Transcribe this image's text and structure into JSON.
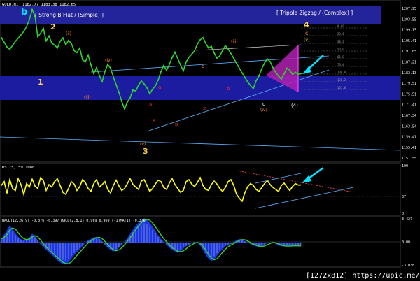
{
  "colors": {
    "bg": "#000000",
    "band": "#1c1ca0",
    "band_top": "#23239a",
    "price": "#2fd32f",
    "rsi": "#ffff00",
    "macd_area": "#1e3cff",
    "macd_line": "#2fd32f",
    "hist": "#c0c0c0",
    "grid": "#404040",
    "cyan": "#00e5ff",
    "magenta": "#b020b0",
    "yellow": "#ffd34a",
    "orange": "#ff8a2a",
    "red": "#ff2a2a",
    "pink": "#ff5fbf",
    "blue_chan": "#5ab0ff",
    "white": "#ffffff"
  },
  "header": {
    "symbol": "GOLD,H1",
    "quote": "1182.77 1183.38 1182.65"
  },
  "main_panel": {
    "label_b": "b",
    "label_2": "2",
    "label_1": "1",
    "label_3": "3",
    "label_4": "4",
    "label_c_orange": "c",
    "label_v_small": "(v)",
    "wave_a": "a",
    "wave_b": "b",
    "wave_c": "c",
    "wave_x": "x",
    "roman_i": "(i)",
    "roman_ii": "(ii)",
    "roman_iii": "(iii)",
    "roman_iv": "(iv)",
    "roman_v": "(v)",
    "paren_4": "(4)",
    "flat_label": "[ Strong B Flat / (Simple) ]",
    "zigzag_label": "[ Tripple Zigzag / (Complex) ]"
  },
  "price_scale": [
    "1207.95",
    "1203.55",
    "1199.15",
    "1195.41",
    "1191.05",
    "1187.21",
    "1183.13",
    "1179.51",
    "1175.51",
    "1171.41",
    "1167.34",
    "1163.54",
    "1159.41",
    "1155.41",
    "1151.55"
  ],
  "rsi_panel": {
    "title": "RSI(5) 59.1088",
    "levels": [
      "100",
      "37",
      "0"
    ]
  },
  "macd_panel": {
    "title": "MACD(12,26,9) -0.376 -0.397  MACD(2,8,1) 0.969 0.969  (-1)MA(1) -0.376",
    "levels": [
      "3.427",
      "0.00",
      "-3.038"
    ]
  },
  "footer": {
    "watermark": "[1272x812] https://upic.me/"
  },
  "fib_levels": [
    "0.00",
    "23.6",
    "38.2",
    "50.0",
    "61.8",
    "76.4",
    "100.0",
    "138.2",
    "161.8"
  ],
  "chart_data": {
    "type": "line",
    "title": "GOLD,H1",
    "series": [
      {
        "name": "GOLD,H1",
        "x": [
          0,
          4,
          8,
          12,
          16,
          20,
          24,
          28,
          32,
          36,
          40,
          44,
          48,
          52,
          56,
          60,
          64,
          68,
          72,
          76,
          80,
          84,
          88,
          92,
          96,
          100,
          104,
          108,
          112,
          116,
          120,
          124,
          128,
          132,
          136,
          140,
          144,
          148,
          152,
          156,
          160,
          164,
          168,
          172,
          176,
          180,
          184,
          188,
          192,
          196,
          200,
          204,
          208,
          212,
          216,
          220,
          224,
          228,
          232,
          236,
          240,
          244,
          248,
          252,
          256,
          260,
          264,
          268,
          272,
          276,
          280,
          284,
          288,
          292,
          296,
          300,
          304,
          308,
          312,
          316,
          320,
          324,
          328,
          332,
          336,
          340,
          344,
          348,
          352,
          356,
          360,
          364,
          368,
          372,
          376,
          380,
          384,
          388,
          392,
          396,
          400,
          404,
          408,
          412,
          416,
          420,
          424,
          428
        ],
        "values": [
          1196.2,
          1194.5,
          1192.8,
          1191.9,
          1193.4,
          1194.8,
          1196.0,
          1197.2,
          1198.5,
          1200.2,
          1202.8,
          1206.5,
          1204.1,
          1196.5,
          1197.8,
          1199.6,
          1195.0,
          1196.8,
          1194.2,
          1193.5,
          1192.4,
          1194.9,
          1196.1,
          1193.6,
          1195.2,
          1194.0,
          1191.5,
          1190.7,
          1192.4,
          1188.1,
          1187.3,
          1189.8,
          1186.2,
          1183.0,
          1185.2,
          1182.3,
          1180.1,
          1183.8,
          1186.4,
          1185.0,
          1181.8,
          1178.9,
          1176.1,
          1172.8,
          1170.0,
          1172.6,
          1174.1,
          1177.0,
          1176.6,
          1178.8,
          1180.3,
          1179.2,
          1177.8,
          1175.6,
          1177.3,
          1178.5,
          1180.6,
          1183.7,
          1186.0,
          1184.2,
          1186.4,
          1188.9,
          1190.9,
          1188.5,
          1186.1,
          1184.0,
          1187.3,
          1189.0,
          1190.1,
          1191.4,
          1193.8,
          1195.4,
          1196.2,
          1194.1,
          1192.4,
          1193.0,
          1190.6,
          1188.7,
          1189.5,
          1191.5,
          1193.3,
          1192.0,
          1190.4,
          1188.6,
          1186.8,
          1185.0,
          1183.2,
          1181.6,
          1179.9,
          1178.6,
          1177.5,
          1180.4,
          1182.1,
          1184.8,
          1186.9,
          1188.4,
          1187.4,
          1185.2,
          1183.4,
          1182.1,
          1181.0,
          1182.9,
          1185.0,
          1184.3,
          1182.7,
          1183.5,
          1182.77,
          1183.0
        ]
      }
    ],
    "rsi_values": [
      58,
      66,
      42,
      70,
      52,
      48,
      72,
      60,
      40,
      62,
      55,
      71,
      57,
      52,
      74,
      68,
      48,
      60,
      55,
      66,
      72,
      58,
      44,
      40,
      52,
      66,
      61,
      48,
      56,
      70,
      64,
      52,
      46,
      62,
      70,
      55,
      60,
      66,
      50,
      43,
      58,
      69,
      57,
      48,
      52,
      62,
      72,
      60,
      55,
      50,
      67,
      70,
      58,
      46,
      52,
      61,
      69,
      66,
      54,
      50,
      63,
      72,
      60,
      52,
      44,
      48,
      66,
      70,
      61,
      56,
      64,
      74,
      58,
      50,
      48,
      60,
      67,
      61,
      52,
      46,
      54,
      66,
      70,
      58,
      40,
      32,
      26,
      44,
      56,
      62,
      58,
      50,
      46,
      54,
      62,
      68,
      60,
      54,
      50,
      46,
      58,
      63,
      55,
      48,
      56,
      62,
      59,
      59.1
    ],
    "macd_values": [
      0.6,
      1.2,
      1.8,
      2.4,
      2.0,
      1.4,
      0.9,
      0.6,
      0.4,
      0.5,
      0.8,
      1.3,
      1.0,
      0.4,
      -0.1,
      -0.5,
      -0.9,
      -1.2,
      -1.6,
      -1.9,
      -2.3,
      -2.6,
      -2.8,
      -2.9,
      -2.6,
      -2.1,
      -1.6,
      -1.2,
      -0.8,
      -0.4,
      0.1,
      0.4,
      0.6,
      0.8,
      0.9,
      0.7,
      0.3,
      -0.2,
      -0.6,
      -0.9,
      -1.1,
      -1.0,
      -0.6,
      -0.2,
      0.2,
      0.7,
      1.3,
      1.9,
      2.4,
      2.8,
      3.1,
      3.4,
      3.2,
      2.8,
      2.3,
      1.7,
      1.1,
      0.6,
      0.2,
      -0.2,
      -0.6,
      -0.9,
      -1.1,
      -1.3,
      -1.1,
      -0.7,
      -0.4,
      -0.2,
      0.0,
      0.2,
      0.1,
      -0.3,
      -0.9,
      -1.6,
      -2.1,
      -2.4,
      -2.2,
      -1.7,
      -1.2,
      -0.8,
      -0.4,
      -0.2,
      -0.1,
      0.2,
      0.4,
      0.6,
      0.5,
      0.3,
      0.1,
      -0.1,
      -0.3,
      -0.4,
      -0.5,
      -0.4,
      -0.2,
      0.0,
      0.1,
      0.2,
      -0.1,
      -0.3,
      -0.4,
      -0.38,
      -0.376,
      -0.36,
      -0.33,
      -0.34,
      -0.376,
      -0.376
    ],
    "ylim": [
      1151.55,
      1207.95
    ],
    "rsi_ylim": [
      0,
      100
    ],
    "macd_ylim": [
      -3.038,
      3.427
    ],
    "grid": false
  }
}
